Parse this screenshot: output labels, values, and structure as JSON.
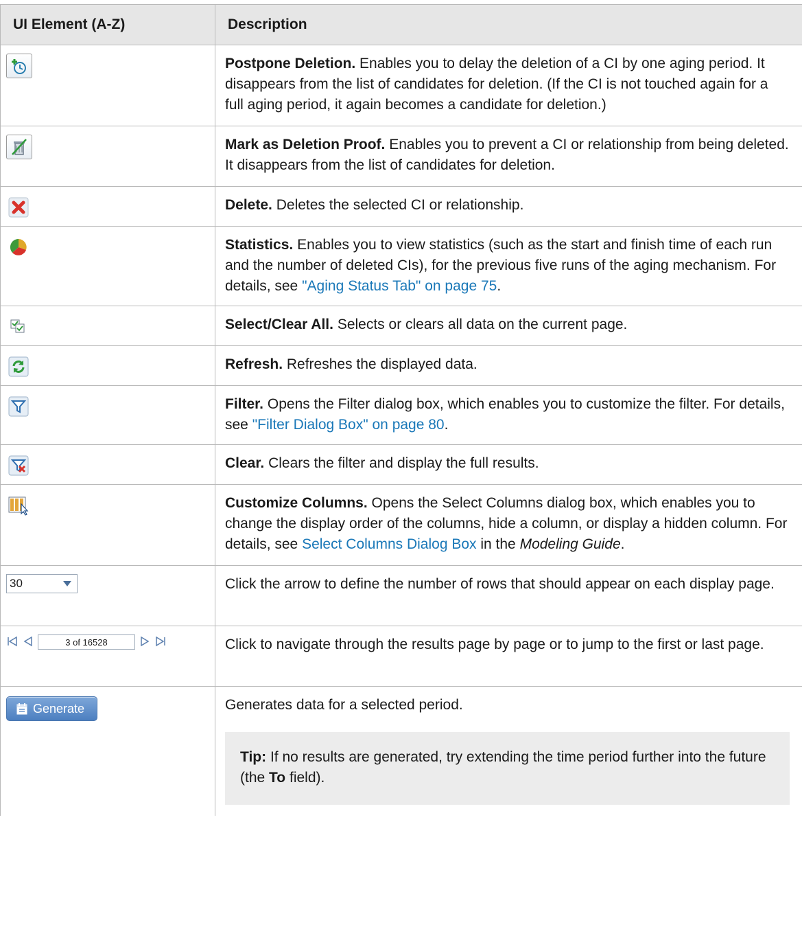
{
  "header": {
    "col1": "UI Element (A-Z)",
    "col2": "Description"
  },
  "rows": [
    {
      "icon": "postpone-deletion-icon",
      "title": "Postpone Deletion.",
      "text": "Enables you to delay the deletion of a CI by one aging period. It disappears from the list of candidates for deletion. (If the CI is not touched again for a full aging period, it again becomes a candidate for deletion.)"
    },
    {
      "icon": "deletion-proof-icon",
      "title": "Mark as Deletion Proof.",
      "text": "Enables you to prevent a CI or relationship from being deleted. It disappears from the list of candidates for deletion."
    },
    {
      "icon": "delete-icon",
      "title": "Delete.",
      "text": "Deletes the selected CI or relationship."
    },
    {
      "icon": "statistics-icon",
      "title": "Statistics.",
      "text": "Enables you to view statistics (such as the start and finish time of each run and the number of deleted CIs), for the previous five runs of the aging mechanism. For details, see",
      "link": "\"Aging Status Tab\" on page 75",
      "after": "."
    },
    {
      "icon": "select-clear-all-icon",
      "title": "Select/Clear All.",
      "text": "Selects or clears all data on the current page."
    },
    {
      "icon": "refresh-icon",
      "title": "Refresh.",
      "text": "Refreshes the displayed data."
    },
    {
      "icon": "filter-icon",
      "title": "Filter.",
      "text": "Opens the Filter dialog box, which enables you to customize the filter. For details, see",
      "link": "\"Filter Dialog Box\" on page 80",
      "after": "."
    },
    {
      "icon": "clear-filter-icon",
      "title": "Clear.",
      "text": "Clears the filter and display the full results."
    },
    {
      "icon": "customize-columns-icon",
      "title": "Customize Columns.",
      "text": "Opens the Select Columns dialog box, which enables you to change the display order of the columns, hide a column, or display a hidden column. For details, see",
      "link": "Select Columns Dialog Box",
      "after_pre": " in the ",
      "after_italic": "Modeling Guide",
      "after": "."
    },
    {
      "icon": "rows-per-page-dropdown",
      "combo_value": "30",
      "text": "Click the arrow to define the number of rows that should appear on each display page."
    },
    {
      "icon": "page-navigator",
      "pager_value": "3 of 16528",
      "text": "Click to navigate through the results page by page or to jump to the first or last page."
    },
    {
      "icon": "generate-button",
      "button_label": "Generate",
      "text": "Generates data for a selected period.",
      "tip_label": "Tip:",
      "tip_text_1": "If no results are generated, try extending the time period further into the future (the",
      "tip_bold": "To",
      "tip_text_2": "field)."
    }
  ]
}
